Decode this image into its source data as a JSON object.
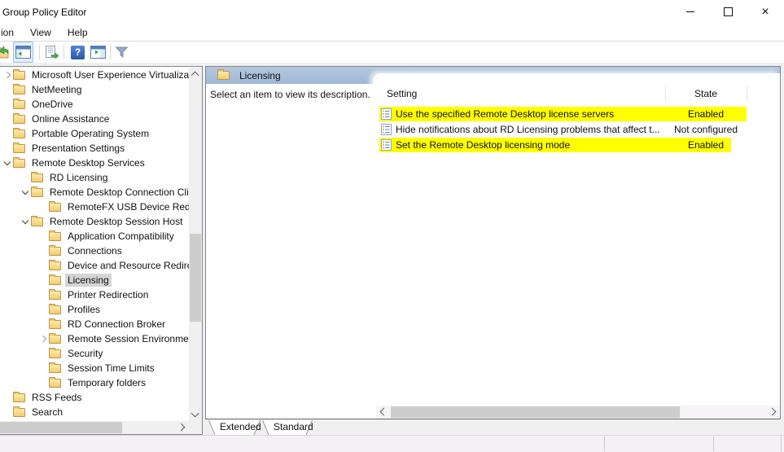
{
  "window": {
    "title": "Group Policy Editor"
  },
  "menu": {
    "items": [
      "ion",
      "View",
      "Help"
    ]
  },
  "toolbar": {
    "icons": [
      "console-window-icon",
      "show-console-tree-icon",
      "export-list-icon",
      "help-icon",
      "show-action-pane-icon",
      "filter-icon"
    ],
    "help_glyph": "?"
  },
  "tree": {
    "items": [
      {
        "label": "Microsoft User Experience Virtualizat",
        "level": 1,
        "expand": "closed"
      },
      {
        "label": "NetMeeting",
        "level": 1
      },
      {
        "label": "OneDrive",
        "level": 1
      },
      {
        "label": "Online Assistance",
        "level": 1
      },
      {
        "label": "Portable Operating System",
        "level": 1
      },
      {
        "label": "Presentation Settings",
        "level": 1
      },
      {
        "label": "Remote Desktop Services",
        "level": 1,
        "expand": "open"
      },
      {
        "label": "RD Licensing",
        "level": 2
      },
      {
        "label": "Remote Desktop Connection Cli",
        "level": 2,
        "expand": "open"
      },
      {
        "label": "RemoteFX USB Device Redire",
        "level": 3
      },
      {
        "label": "Remote Desktop Session Host",
        "level": 2,
        "expand": "open"
      },
      {
        "label": "Application Compatibility",
        "level": 3
      },
      {
        "label": "Connections",
        "level": 3
      },
      {
        "label": "Device and Resource Redirect",
        "level": 3
      },
      {
        "label": "Licensing",
        "level": 3,
        "selected": true
      },
      {
        "label": "Printer Redirection",
        "level": 3
      },
      {
        "label": "Profiles",
        "level": 3
      },
      {
        "label": "RD Connection Broker",
        "level": 3
      },
      {
        "label": "Remote Session Environment",
        "level": 3,
        "expand": "closed"
      },
      {
        "label": "Security",
        "level": 3
      },
      {
        "label": "Session Time Limits",
        "level": 3
      },
      {
        "label": "Temporary folders",
        "level": 3
      },
      {
        "label": "RSS Feeds",
        "level": 1
      },
      {
        "label": "Search",
        "level": 1
      }
    ]
  },
  "rightPanel": {
    "header": "Licensing",
    "description": "Select an item to view its description.",
    "columns": {
      "setting": "Setting",
      "state": "State"
    },
    "rows": [
      {
        "setting": "Use the specified Remote Desktop license servers",
        "state": "Enabled",
        "highlight": true
      },
      {
        "setting": "Hide notifications about RD Licensing problems that affect t...",
        "state": "Not configured",
        "highlight": false
      },
      {
        "setting": "Set the Remote Desktop licensing mode",
        "state": "Enabled",
        "highlight": true
      }
    ],
    "highlight_color": "#ffff00",
    "tabs": [
      "Extended",
      "Standard"
    ]
  }
}
